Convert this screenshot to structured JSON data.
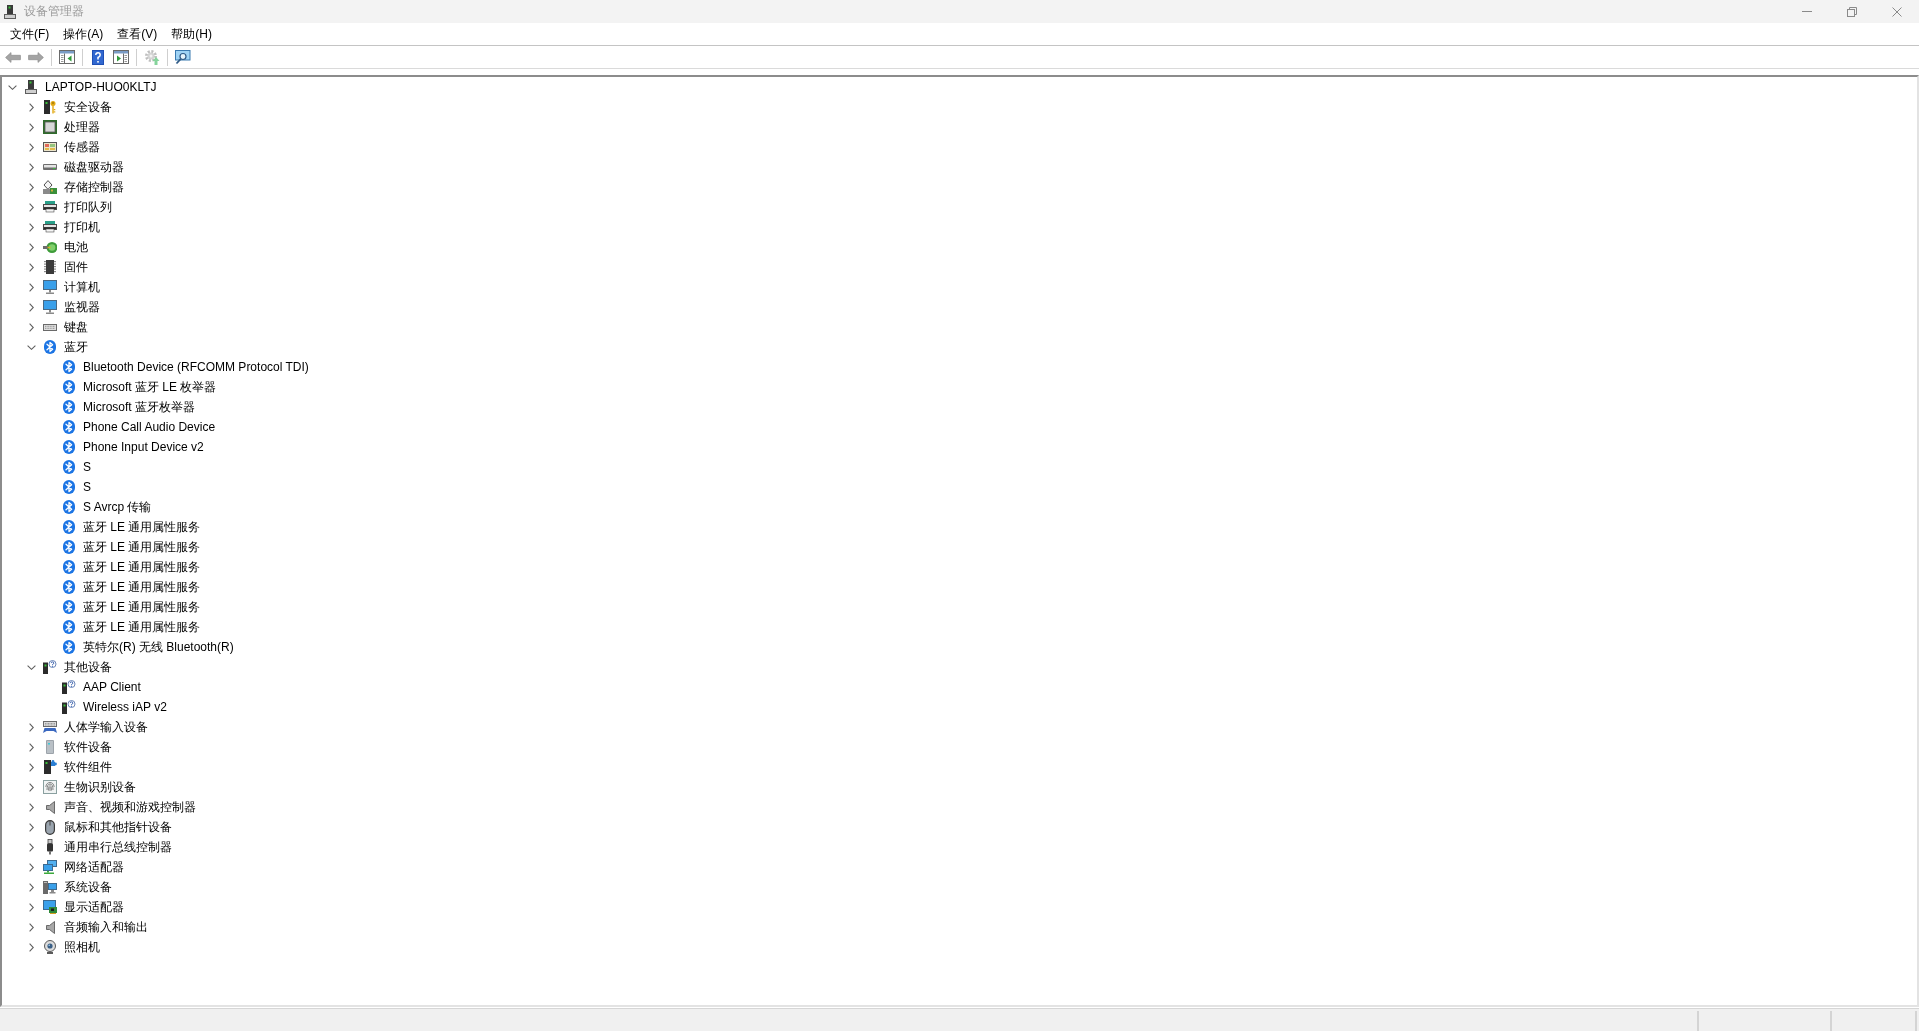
{
  "window": {
    "title": "设备管理器"
  },
  "menu_bar": [
    "文件(F)",
    "操作(A)",
    "查看(V)",
    "帮助(H)"
  ],
  "toolbar": {
    "groups": [
      {
        "buttons": [
          {
            "kind": "back",
            "disabled": true
          },
          {
            "kind": "forward",
            "disabled": true
          }
        ]
      },
      {
        "buttons": [
          {
            "kind": "consoletree",
            "disabled": false
          }
        ]
      },
      {
        "buttons": [
          {
            "kind": "help",
            "disabled": false
          },
          {
            "kind": "actionpane",
            "disabled": false
          }
        ]
      },
      {
        "buttons": [
          {
            "kind": "update",
            "disabled": true
          }
        ]
      },
      {
        "buttons": [
          {
            "kind": "scan",
            "disabled": false
          }
        ]
      }
    ]
  },
  "device_tree": [
    {
      "label": "LAPTOP-HUO0KLTJ",
      "kind": "pc",
      "expanded": true,
      "children": [
        {
          "label": "安全设备",
          "kind": "security",
          "expanded": false
        },
        {
          "label": "处理器",
          "kind": "processor",
          "expanded": false
        },
        {
          "label": "传感器",
          "kind": "sensor",
          "expanded": false
        },
        {
          "label": "磁盘驱动器",
          "kind": "disk",
          "expanded": false
        },
        {
          "label": "存储控制器",
          "kind": "storage",
          "expanded": false
        },
        {
          "label": "打印队列",
          "kind": "printer",
          "expanded": false
        },
        {
          "label": "打印机",
          "kind": "printer",
          "expanded": false
        },
        {
          "label": "电池",
          "kind": "battery",
          "expanded": false
        },
        {
          "label": "固件",
          "kind": "firmware",
          "expanded": false
        },
        {
          "label": "计算机",
          "kind": "computer",
          "expanded": false
        },
        {
          "label": "监视器",
          "kind": "monitor",
          "expanded": false
        },
        {
          "label": "键盘",
          "kind": "keyboard",
          "expanded": false
        },
        {
          "label": "蓝牙",
          "kind": "bluetooth",
          "expanded": true,
          "children": [
            {
              "label": "Bluetooth Device (RFCOMM Protocol TDI)",
              "kind": "bluetooth"
            },
            {
              "label": "Microsoft 蓝牙 LE 枚举器",
              "kind": "bluetooth"
            },
            {
              "label": "Microsoft 蓝牙枚举器",
              "kind": "bluetooth"
            },
            {
              "label": "Phone Call Audio Device",
              "kind": "bluetooth"
            },
            {
              "label": "Phone Input Device v2",
              "kind": "bluetooth"
            },
            {
              "label": "S",
              "kind": "bluetooth"
            },
            {
              "label": "S",
              "kind": "bluetooth"
            },
            {
              "label": "S Avrcp 传输",
              "kind": "bluetooth"
            },
            {
              "label": "蓝牙 LE 通用属性服务",
              "kind": "bluetooth"
            },
            {
              "label": "蓝牙 LE 通用属性服务",
              "kind": "bluetooth"
            },
            {
              "label": "蓝牙 LE 通用属性服务",
              "kind": "bluetooth"
            },
            {
              "label": "蓝牙 LE 通用属性服务",
              "kind": "bluetooth"
            },
            {
              "label": "蓝牙 LE 通用属性服务",
              "kind": "bluetooth"
            },
            {
              "label": "蓝牙 LE 通用属性服务",
              "kind": "bluetooth"
            },
            {
              "label": "英特尔(R) 无线 Bluetooth(R)",
              "kind": "bluetooth"
            }
          ]
        },
        {
          "label": "其他设备",
          "kind": "unknown",
          "expanded": true,
          "children": [
            {
              "label": "AAP Client",
              "kind": "unknown"
            },
            {
              "label": "Wireless iAP v2",
              "kind": "unknown"
            }
          ]
        },
        {
          "label": "人体学输入设备",
          "kind": "hid",
          "expanded": false
        },
        {
          "label": "软件设备",
          "kind": "softwaredevice",
          "expanded": false
        },
        {
          "label": "软件组件",
          "kind": "softwarecomponent",
          "expanded": false
        },
        {
          "label": "生物识别设备",
          "kind": "biometric",
          "expanded": false
        },
        {
          "label": "声音、视频和游戏控制器",
          "kind": "sound",
          "expanded": false
        },
        {
          "label": "鼠标和其他指针设备",
          "kind": "mouse",
          "expanded": false
        },
        {
          "label": "通用串行总线控制器",
          "kind": "usb",
          "expanded": false
        },
        {
          "label": "网络适配器",
          "kind": "network",
          "expanded": false
        },
        {
          "label": "系统设备",
          "kind": "system",
          "expanded": false
        },
        {
          "label": "显示适配器",
          "kind": "display",
          "expanded": false
        },
        {
          "label": "音频输入和输出",
          "kind": "sound",
          "expanded": false
        },
        {
          "label": "照相机",
          "kind": "camera",
          "expanded": false
        }
      ]
    }
  ]
}
